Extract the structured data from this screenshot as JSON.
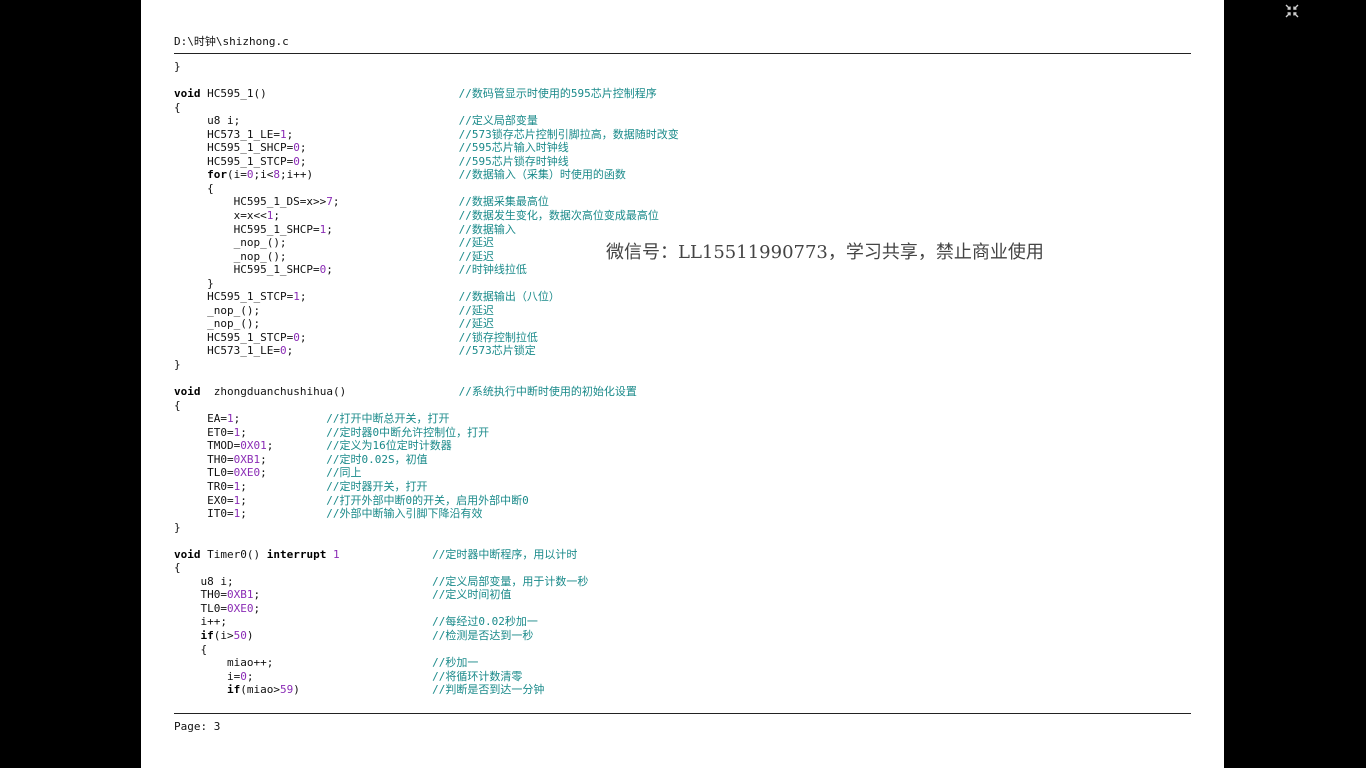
{
  "document": {
    "file_path": "D:\\时钟\\shizhong.c",
    "page_label": "Page: 3",
    "watermark": "微信号：LL15511990773，学习共享，禁止商业使用"
  },
  "code_lines": [
    {
      "indent": 0,
      "parts": [
        {
          "t": "}"
        }
      ]
    },
    {
      "indent": 0,
      "parts": []
    },
    {
      "indent": 0,
      "parts": [
        {
          "t": "void",
          "c": "kw"
        },
        {
          "t": " HC595_1()"
        }
      ],
      "comment_col": 43,
      "comment": "//数码管显示时使用的595芯片控制程序"
    },
    {
      "indent": 0,
      "parts": [
        {
          "t": "{"
        }
      ]
    },
    {
      "indent": 5,
      "parts": [
        {
          "t": "u8 i;"
        }
      ],
      "comment_col": 43,
      "comment": "//定义局部变量"
    },
    {
      "indent": 5,
      "parts": [
        {
          "t": "HC573_1_LE="
        },
        {
          "t": "1",
          "c": "num"
        },
        {
          "t": ";"
        }
      ],
      "comment_col": 43,
      "comment": "//573锁存芯片控制引脚拉高，数据随时改变"
    },
    {
      "indent": 5,
      "parts": [
        {
          "t": "HC595_1_SHCP="
        },
        {
          "t": "0",
          "c": "num"
        },
        {
          "t": ";"
        }
      ],
      "comment_col": 43,
      "comment": "//595芯片输入时钟线"
    },
    {
      "indent": 5,
      "parts": [
        {
          "t": "HC595_1_STCP="
        },
        {
          "t": "0",
          "c": "num"
        },
        {
          "t": ";"
        }
      ],
      "comment_col": 43,
      "comment": "//595芯片锁存时钟线"
    },
    {
      "indent": 5,
      "parts": [
        {
          "t": "for",
          "c": "kw"
        },
        {
          "t": "(i="
        },
        {
          "t": "0",
          "c": "num"
        },
        {
          "t": ";i<"
        },
        {
          "t": "8",
          "c": "num"
        },
        {
          "t": ";i++)"
        }
      ],
      "comment_col": 43,
      "comment": "//数据输入（采集）时使用的函数"
    },
    {
      "indent": 5,
      "parts": [
        {
          "t": "{"
        }
      ]
    },
    {
      "indent": 9,
      "parts": [
        {
          "t": "HC595_1_DS=x>>"
        },
        {
          "t": "7",
          "c": "num"
        },
        {
          "t": ";"
        }
      ],
      "comment_col": 43,
      "comment": "//数据采集最高位"
    },
    {
      "indent": 9,
      "parts": [
        {
          "t": "x=x<<"
        },
        {
          "t": "1",
          "c": "num"
        },
        {
          "t": ";"
        }
      ],
      "comment_col": 43,
      "comment": "//数据发生变化，数据次高位变成最高位"
    },
    {
      "indent": 9,
      "parts": [
        {
          "t": "HC595_1_SHCP="
        },
        {
          "t": "1",
          "c": "num"
        },
        {
          "t": ";"
        }
      ],
      "comment_col": 43,
      "comment": "//数据输入"
    },
    {
      "indent": 9,
      "parts": [
        {
          "t": "_nop_();"
        }
      ],
      "comment_col": 43,
      "comment": "//延迟"
    },
    {
      "indent": 9,
      "parts": [
        {
          "t": "_nop_();"
        }
      ],
      "comment_col": 43,
      "comment": "//延迟"
    },
    {
      "indent": 9,
      "parts": [
        {
          "t": "HC595_1_SHCP="
        },
        {
          "t": "0",
          "c": "num"
        },
        {
          "t": ";"
        }
      ],
      "comment_col": 43,
      "comment": "//时钟线拉低"
    },
    {
      "indent": 5,
      "parts": [
        {
          "t": "}"
        }
      ]
    },
    {
      "indent": 5,
      "parts": [
        {
          "t": "HC595_1_STCP="
        },
        {
          "t": "1",
          "c": "num"
        },
        {
          "t": ";"
        }
      ],
      "comment_col": 43,
      "comment": "//数据输出（八位）"
    },
    {
      "indent": 5,
      "parts": [
        {
          "t": "_nop_();"
        }
      ],
      "comment_col": 43,
      "comment": "//延迟"
    },
    {
      "indent": 5,
      "parts": [
        {
          "t": "_nop_();"
        }
      ],
      "comment_col": 43,
      "comment": "//延迟"
    },
    {
      "indent": 5,
      "parts": [
        {
          "t": "HC595_1_STCP="
        },
        {
          "t": "0",
          "c": "num"
        },
        {
          "t": ";"
        }
      ],
      "comment_col": 43,
      "comment": "//锁存控制拉低"
    },
    {
      "indent": 5,
      "parts": [
        {
          "t": "HC573_1_LE="
        },
        {
          "t": "0",
          "c": "num"
        },
        {
          "t": ";"
        }
      ],
      "comment_col": 43,
      "comment": "//573芯片锁定"
    },
    {
      "indent": 0,
      "parts": [
        {
          "t": "}"
        }
      ]
    },
    {
      "indent": 0,
      "parts": []
    },
    {
      "indent": 0,
      "parts": [
        {
          "t": "void",
          "c": "kw"
        },
        {
          "t": "  zhongduanchushihua()"
        }
      ],
      "comment_col": 43,
      "comment": "//系统执行中断时使用的初始化设置"
    },
    {
      "indent": 0,
      "parts": [
        {
          "t": "{"
        }
      ]
    },
    {
      "indent": 5,
      "parts": [
        {
          "t": "EA="
        },
        {
          "t": "1",
          "c": "num"
        },
        {
          "t": ";"
        }
      ],
      "comment_col": 23,
      "comment": "//打开中断总开关，打开"
    },
    {
      "indent": 5,
      "parts": [
        {
          "t": "ET0="
        },
        {
          "t": "1",
          "c": "num"
        },
        {
          "t": ";"
        }
      ],
      "comment_col": 23,
      "comment": "//定时器0中断允许控制位，打开"
    },
    {
      "indent": 5,
      "parts": [
        {
          "t": "TMOD="
        },
        {
          "t": "0X01",
          "c": "num"
        },
        {
          "t": ";"
        }
      ],
      "comment_col": 23,
      "comment": "//定义为16位定时计数器"
    },
    {
      "indent": 5,
      "parts": [
        {
          "t": "TH0="
        },
        {
          "t": "0XB1",
          "c": "num"
        },
        {
          "t": ";"
        }
      ],
      "comment_col": 23,
      "comment": "//定时0.02S，初值"
    },
    {
      "indent": 5,
      "parts": [
        {
          "t": "TL0="
        },
        {
          "t": "0XE0",
          "c": "num"
        },
        {
          "t": ";"
        }
      ],
      "comment_col": 23,
      "comment": "//同上"
    },
    {
      "indent": 5,
      "parts": [
        {
          "t": "TR0="
        },
        {
          "t": "1",
          "c": "num"
        },
        {
          "t": ";"
        }
      ],
      "comment_col": 23,
      "comment": "//定时器开关，打开"
    },
    {
      "indent": 5,
      "parts": [
        {
          "t": "EX0="
        },
        {
          "t": "1",
          "c": "num"
        },
        {
          "t": ";"
        }
      ],
      "comment_col": 23,
      "comment": "//打开外部中断0的开关，启用外部中断0"
    },
    {
      "indent": 5,
      "parts": [
        {
          "t": "IT0="
        },
        {
          "t": "1",
          "c": "num"
        },
        {
          "t": ";"
        }
      ],
      "comment_col": 23,
      "comment": "//外部中断输入引脚下降沿有效"
    },
    {
      "indent": 0,
      "parts": [
        {
          "t": "}"
        }
      ]
    },
    {
      "indent": 0,
      "parts": []
    },
    {
      "indent": 0,
      "parts": [
        {
          "t": "void",
          "c": "kw"
        },
        {
          "t": " Timer0() "
        },
        {
          "t": "interrupt",
          "c": "kw"
        },
        {
          "t": " "
        },
        {
          "t": "1",
          "c": "num"
        }
      ],
      "comment_col": 39,
      "comment": "//定时器中断程序，用以计时"
    },
    {
      "indent": 0,
      "parts": [
        {
          "t": "{"
        }
      ]
    },
    {
      "indent": 4,
      "parts": [
        {
          "t": "u8 i;"
        }
      ],
      "comment_col": 39,
      "comment": "//定义局部变量，用于计数一秒"
    },
    {
      "indent": 4,
      "parts": [
        {
          "t": "TH0="
        },
        {
          "t": "0XB1",
          "c": "num"
        },
        {
          "t": ";"
        }
      ],
      "comment_col": 39,
      "comment": "//定义时间初值"
    },
    {
      "indent": 4,
      "parts": [
        {
          "t": "TL0="
        },
        {
          "t": "0XE0",
          "c": "num"
        },
        {
          "t": ";"
        }
      ]
    },
    {
      "indent": 4,
      "parts": [
        {
          "t": "i++;"
        }
      ],
      "comment_col": 39,
      "comment": "//每经过0.02秒加一"
    },
    {
      "indent": 4,
      "parts": [
        {
          "t": "if",
          "c": "kw"
        },
        {
          "t": "(i>"
        },
        {
          "t": "50",
          "c": "num"
        },
        {
          "t": ")"
        }
      ],
      "comment_col": 39,
      "comment": "//检测是否达到一秒"
    },
    {
      "indent": 4,
      "parts": [
        {
          "t": "{"
        }
      ]
    },
    {
      "indent": 8,
      "parts": [
        {
          "t": "miao++;"
        }
      ],
      "comment_col": 39,
      "comment": "//秒加一"
    },
    {
      "indent": 8,
      "parts": [
        {
          "t": "i="
        },
        {
          "t": "0",
          "c": "num"
        },
        {
          "t": ";"
        }
      ],
      "comment_col": 39,
      "comment": "//将循环计数清零"
    },
    {
      "indent": 8,
      "parts": [
        {
          "t": "if",
          "c": "kw"
        },
        {
          "t": "(miao>"
        },
        {
          "t": "59",
          "c": "num"
        },
        {
          "t": ")"
        }
      ],
      "comment_col": 39,
      "comment": "//判断是否到达一分钟"
    }
  ]
}
